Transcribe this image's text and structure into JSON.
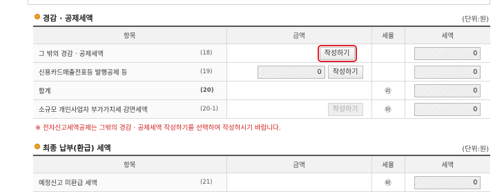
{
  "section1": {
    "title": "경감 · 공제세액",
    "unit": "(단위:원)",
    "headers": [
      "항목",
      "금액",
      "세율",
      "세액"
    ],
    "rows": [
      {
        "label": "그 밖의 경감 · 공제세액",
        "code": "(18)",
        "amount": "",
        "button": "작성하기",
        "rate": "",
        "tax": "0"
      },
      {
        "label": "신용카드매출전표등 발행공제 등",
        "code": "(19)",
        "amount": "0",
        "button": "작성하기",
        "rate": "",
        "tax": "0"
      },
      {
        "label": "합계",
        "code": "(20)",
        "amount": "",
        "button": "",
        "rate": "㉱",
        "tax": "0"
      },
      {
        "label": "소규모 개인사업자 부가가치세 감면세액",
        "code": "(20-1)",
        "amount": "",
        "button": "작성하기",
        "rate": "㉲",
        "tax": "0"
      }
    ],
    "note": "※ 전자신고세액공제는 그밖의 경감 · 공제세액 작성하기를 선택하여 작성하시기 바랍니다."
  },
  "section2": {
    "title": "최종 납부(환급) 세액",
    "unit": "(단위:원)",
    "headers": [
      "항목",
      "금액",
      "세율",
      "세액"
    ],
    "rows": [
      {
        "label": "예정신고 미환급 세액",
        "code": "(21)",
        "rate": "㉳",
        "tax": "0"
      }
    ]
  }
}
